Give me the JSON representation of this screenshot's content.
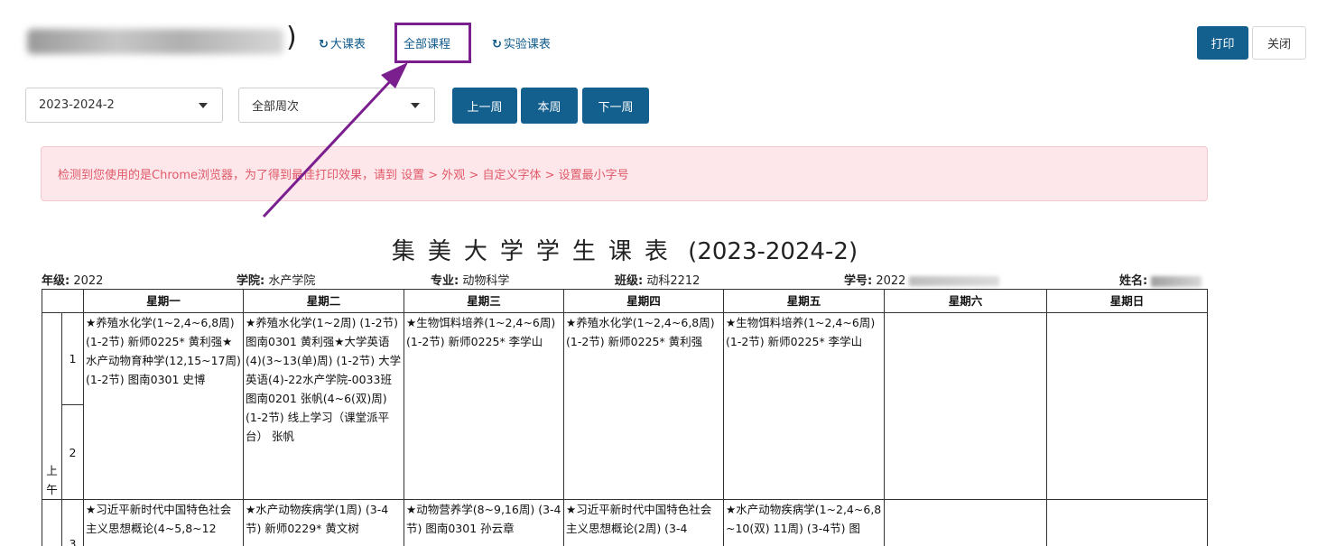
{
  "header": {
    "student_name_visible": "■",
    "close_paren": ")",
    "tabs": [
      {
        "icon": "refresh-icon",
        "label": "大课表"
      },
      {
        "icon": "",
        "label": "全部课程"
      },
      {
        "icon": "refresh-icon",
        "label": "实验课表"
      }
    ],
    "print_label": "打印",
    "close_label": "关闭"
  },
  "filters": {
    "term": "2023-2024-2",
    "week": "全部周次",
    "prev_week": "上一周",
    "this_week": "本周",
    "next_week": "下一周"
  },
  "alert": "检测到您使用的是Chrome浏览器，为了得到最佳打印效果，请到 设置 > 外观 > 自定义字体 > 设置最小字号",
  "schedule": {
    "title_chars": "集美大学学生课表",
    "title_term": "(2023-2024-2)",
    "info": {
      "grade_label": "年级:",
      "grade": "2022",
      "college_label": "学院:",
      "college": "水产学院",
      "major_label": "专业:",
      "major": "动物科学",
      "class_label": "班级:",
      "class": "动科2212",
      "id_label": "学号:",
      "id_prefix": "2022",
      "name_label": "姓名:"
    },
    "days": [
      "星期一",
      "星期二",
      "星期三",
      "星期四",
      "星期五",
      "星期六",
      "星期日"
    ],
    "half_day": "上午",
    "periods": [
      "1",
      "2",
      "3"
    ],
    "row1": [
      "★养殖水化学(1~2,4~6,8周) (1-2节) 新师0225* 黄利强★水产动物育种学(12,15~17周) (1-2节) 图南0301 史博",
      "★养殖水化学(1~2周) (1-2节) 图南0301 黄利强★大学英语(4)(3~13(单)周) (1-2节) 大学英语(4)-22水产学院-0033班 图南0201 张帆(4~6(双)周) (1-2节) 线上学习（课堂派平台） 张帆",
      "★生物饵料培养(1~2,4~6周) (1-2节) 新师0225* 李学山",
      "★养殖水化学(1~2,4~6,8周) (1-2节) 新师0225* 黄利强",
      "★生物饵料培养(1~2,4~6周) (1-2节) 新师0225* 李学山",
      "",
      ""
    ],
    "row2": [
      "★习近平新时代中国特色社会主义思想概论(4~5,8~12",
      "★水产动物疾病学(1周) (3-4节) 新师0229* 黄文树",
      "★动物营养学(8~9,16周) (3-4节) 图南0301 孙云章",
      "★习近平新时代中国特色社会主义思想概论(2周) (3-4",
      "★水产动物疾病学(1~2,4~6,8~10(双) 11周) (3-4节) 图",
      "",
      ""
    ]
  }
}
